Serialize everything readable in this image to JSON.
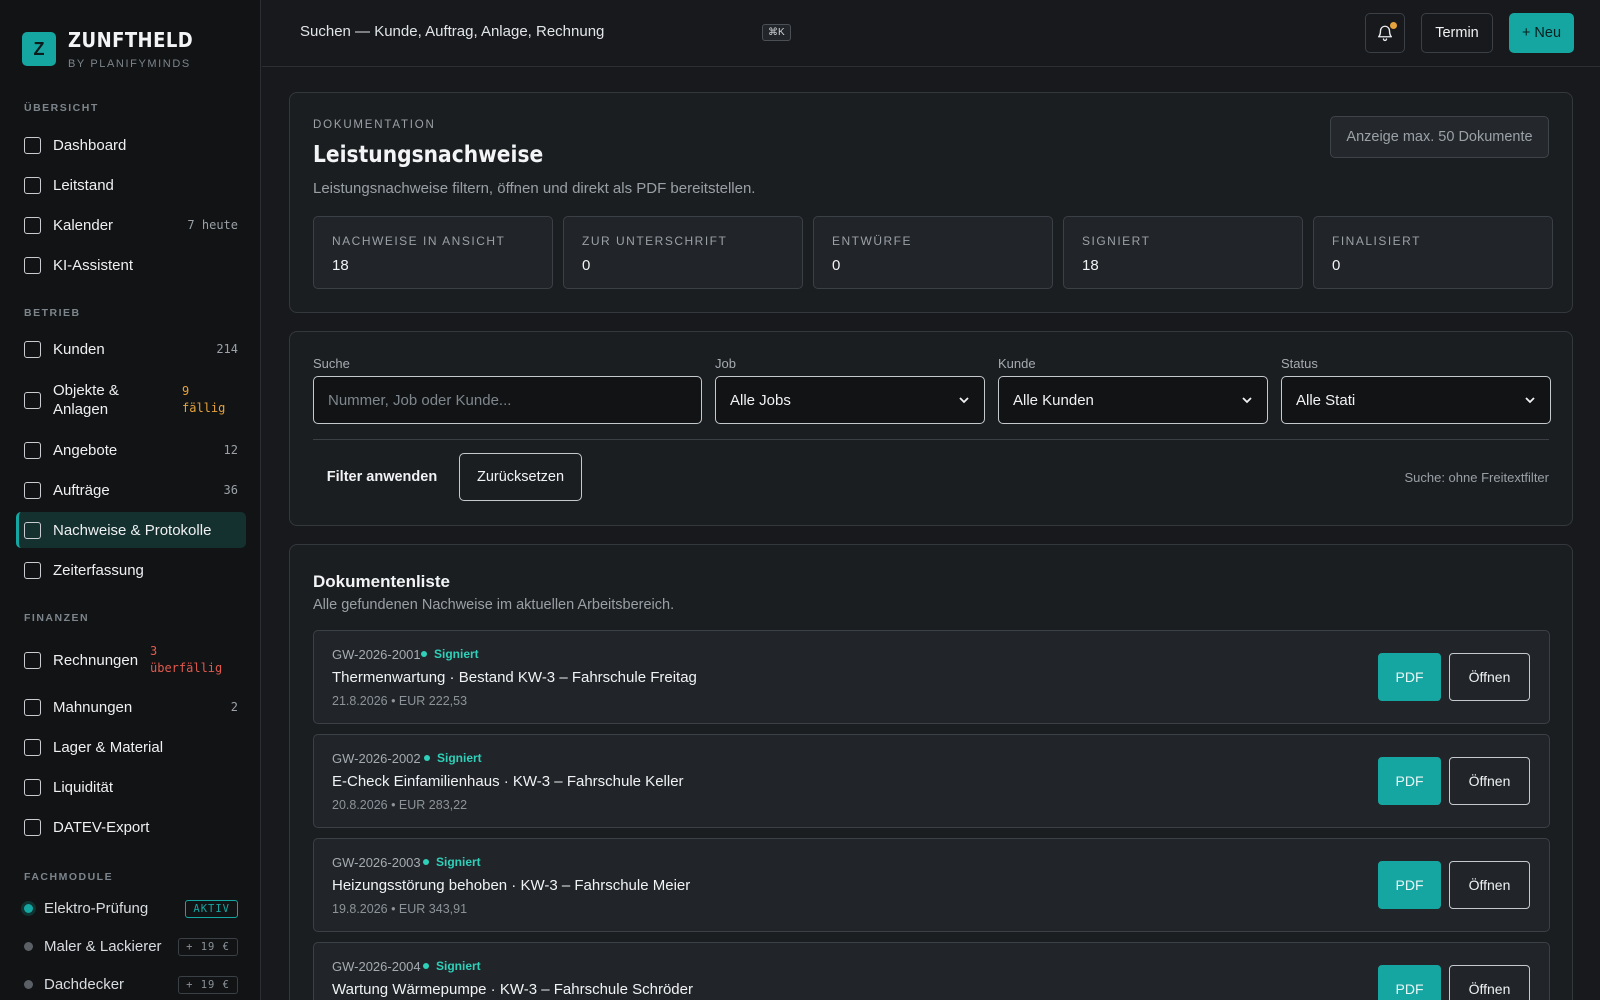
{
  "brand": {
    "logo_letter": "Z",
    "name": "ZUNFTHELD",
    "sub": "BY PLANIFYMINDS"
  },
  "nav": {
    "section_overview": "ÜBERSICHT",
    "dashboard": "Dashboard",
    "leitstand": "Leitstand",
    "kalender": "Kalender",
    "kalender_count": "7 heute",
    "ki": "KI-Assistent",
    "section_betrieb": "BETRIEB",
    "kunden": "Kunden",
    "kunden_count": "214",
    "objekte_line1": "Objekte &",
    "objekte_line2": "Anlagen",
    "objekte_warn_1": "9",
    "objekte_warn_2": "fällig",
    "angebote": "Angebote",
    "angebote_count": "12",
    "auftraege": "Aufträge",
    "auftraege_count": "36",
    "nachweise": "Nachweise & Protokolle",
    "zeiterfassung": "Zeiterfassung",
    "section_finanzen": "FINANZEN",
    "rechnungen": "Rechnungen",
    "rechnungen_warn_1": "3",
    "rechnungen_warn_2": "überfällig",
    "mahnungen": "Mahnungen",
    "mahnungen_count": "2",
    "lager": "Lager & Material",
    "liquiditaet": "Liquidität",
    "datev": "DATEV-Export",
    "section_fach": "FACHMODULE",
    "mod_elektro": "Elektro-Prüfung",
    "mod_elektro_tag": "AKTIV",
    "mod_maler": "Maler & Lackierer",
    "mod_maler_tag": "+ 19 €",
    "mod_dach": "Dachdecker",
    "mod_dach_tag": "+ 19 €"
  },
  "topbar": {
    "search": "Suchen — Kunde, Auftrag, Anlage, Rechnung",
    "shortcut": "⌘K",
    "termin": "Termin",
    "neu": "+ Neu"
  },
  "header": {
    "eyebrow": "DOKUMENTATION",
    "title": "Leistungsnachweise",
    "subtitle": "Leistungsnachweise filtern, öffnen und direkt als PDF bereitstellen.",
    "max_hint": "Anzeige max. 50 Dokumente"
  },
  "stats": [
    {
      "label": "NACHWEISE IN ANSICHT",
      "value": "18"
    },
    {
      "label": "ZUR UNTERSCHRIFT",
      "value": "0"
    },
    {
      "label": "ENTWÜRFE",
      "value": "0"
    },
    {
      "label": "SIGNIERT",
      "value": "18"
    },
    {
      "label": "FINALISIERT",
      "value": "0"
    }
  ],
  "filters": {
    "search_label": "Suche",
    "search_placeholder": "Nummer, Job oder Kunde...",
    "job_label": "Job",
    "job_value": "Alle Jobs",
    "kunde_label": "Kunde",
    "kunde_value": "Alle Kunden",
    "status_label": "Status",
    "status_value": "Alle Stati",
    "apply": "Filter anwenden",
    "reset": "Zurücksetzen",
    "hint": "Suche: ohne Freitextfilter"
  },
  "list": {
    "title": "Dokumentenliste",
    "subtitle": "Alle gefundenen Nachweise im aktuellen Arbeitsbereich.",
    "pdf_label": "PDF",
    "open_label": "Öffnen",
    "items": [
      {
        "number": "GW-2026-2001",
        "status": "Signiert",
        "title": "Thermenwartung · Bestand KW-3 – Fahrschule Freitag",
        "meta": "21.8.2026 • EUR 222,53"
      },
      {
        "number": "GW-2026-2002",
        "status": "Signiert",
        "title": "E-Check Einfamilienhaus · KW-3 – Fahrschule Keller",
        "meta": "20.8.2026 • EUR 283,22"
      },
      {
        "number": "GW-2026-2003",
        "status": "Signiert",
        "title": "Heizungsstörung behoben · KW-3 – Fahrschule Meier",
        "meta": "19.8.2026 • EUR 343,91"
      },
      {
        "number": "GW-2026-2004",
        "status": "Signiert",
        "title": "Wartung Wärmepumpe · KW-3 – Fahrschule Schröder",
        "meta": ""
      }
    ]
  },
  "colors": {
    "accent": "#16a6a2",
    "warning": "#e6a23c",
    "danger": "#e05a4f",
    "signed": "#2fd0b9"
  }
}
